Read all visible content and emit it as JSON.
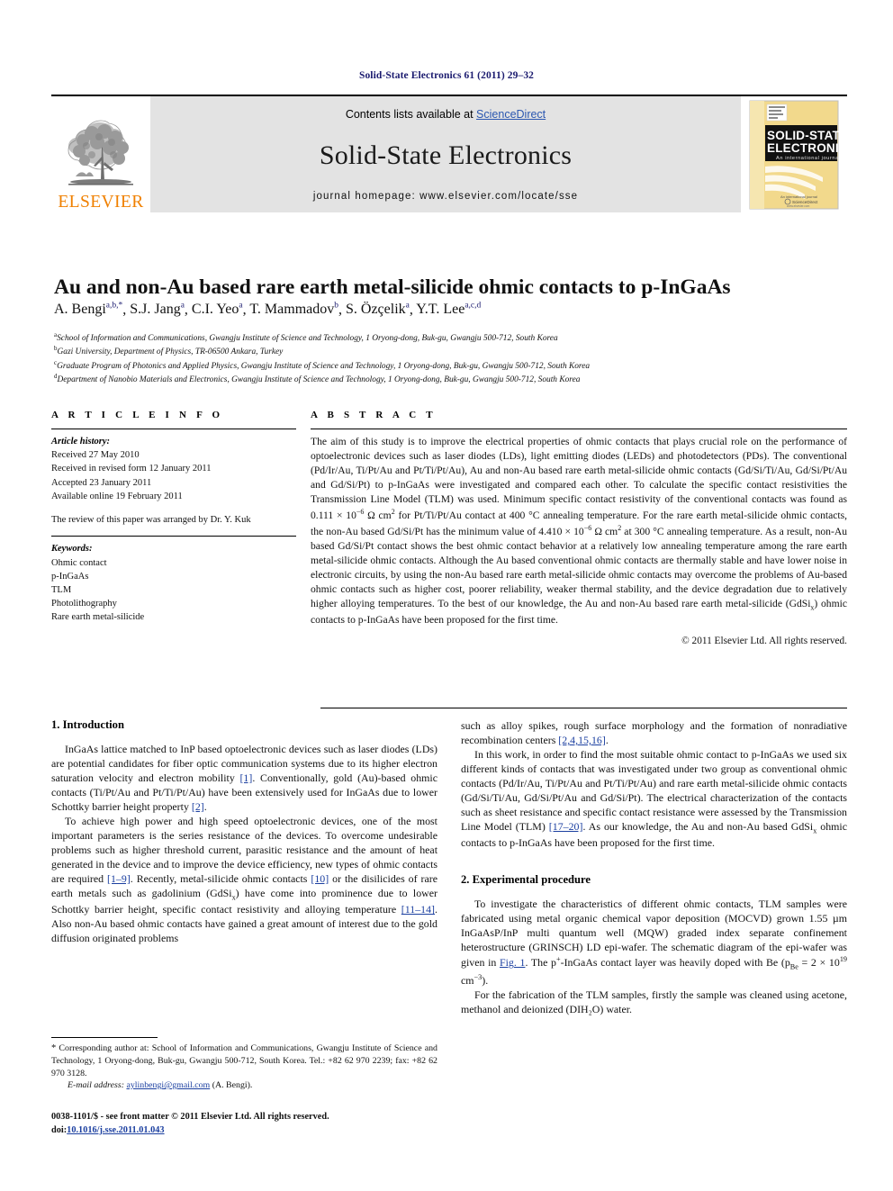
{
  "running_head": "Solid-State Electronics 61 (2011) 29–32",
  "masthead": {
    "publisher_word": "ELSEVIER",
    "publisher_logo_name": "elsevier-tree-logo",
    "contents_prefix": "Contents lists available at ",
    "contents_link": "ScienceDirect",
    "journal_name": "Solid-State Electronics",
    "homepage": "journal homepage: www.elsevier.com/locate/sse",
    "cover": {
      "line1": "SOLID-STATE",
      "line2": "ELECTRONICS",
      "subtitle": "An international journal",
      "footer": "ScienceDirect",
      "footer_sub": "www.elsevier.com"
    }
  },
  "article": {
    "title": "Au and non-Au based rare earth metal-silicide ohmic contacts to p-InGaAs",
    "authors": [
      {
        "name": "A. Bengi",
        "sup": "a,b,*"
      },
      {
        "name": "S.J. Jang",
        "sup": "a"
      },
      {
        "name": "C.I. Yeo",
        "sup": "a"
      },
      {
        "name": "T. Mammadov",
        "sup": "b"
      },
      {
        "name": "S. Özçelik",
        "sup": "a"
      },
      {
        "name": "Y.T. Lee",
        "sup": "a,c,d"
      }
    ],
    "affiliations": [
      {
        "marker": "a",
        "text": "School of Information and Communications, Gwangju Institute of Science and Technology, 1 Oryong-dong, Buk-gu, Gwangju 500-712, South Korea"
      },
      {
        "marker": "b",
        "text": "Gazi University, Department of Physics, TR-06500 Ankara, Turkey"
      },
      {
        "marker": "c",
        "text": "Graduate Program of Photonics and Applied Physics, Gwangju Institute of Science and Technology, 1 Oryong-dong, Buk-gu, Gwangju 500-712, South Korea"
      },
      {
        "marker": "d",
        "text": "Department of Nanobio Materials and Electronics, Gwangju Institute of Science and Technology, 1 Oryong-dong, Buk-gu, Gwangju 500-712, South Korea"
      }
    ]
  },
  "article_info": {
    "heading": "A R T I C L E   I N F O",
    "history_label": "Article history:",
    "history": [
      "Received 27 May 2010",
      "Received in revised form 12 January 2011",
      "Accepted 23 January 2011",
      "Available online 19 February 2011"
    ],
    "editor_note": "The review of this paper was arranged by Dr. Y. Kuk",
    "keywords_label": "Keywords:",
    "keywords": [
      "Ohmic contact",
      "p-InGaAs",
      "TLM",
      "Photolithography",
      "Rare earth metal-silicide"
    ]
  },
  "abstract": {
    "heading": "A B S T R A C T",
    "p1_a": "The aim of this study is to improve the electrical properties of ohmic contacts that plays crucial role on the performance of optoelectronic devices such as laser diodes (LDs), light emitting diodes (LEDs) and photodetectors (PDs). The conventional (Pd/Ir/Au, Ti/Pt/Au and Pt/Ti/Pt/Au), Au and non-Au based rare earth metal-silicide ohmic contacts (Gd/Si/Ti/Au, Gd/Si/Pt/Au and Gd/Si/Pt) to p-InGaAs were investigated and compared each other. To calculate the specific contact resistivities the Transmission Line Model (TLM) was used. Minimum specific contact resistivity of the conventional contacts was found as 0.111 × 10",
    "exp1": "−6",
    "p1_b": " Ω cm",
    "sq1": "2",
    "p1_c": " for Pt/Ti/Pt/Au contact at 400 °C annealing temperature. For the rare earth metal-silicide ohmic contacts, the non-Au based Gd/Si/Pt has the minimum value of 4.410 × 10",
    "exp2": "−6",
    "p1_d": " Ω cm",
    "sq2": "2",
    "p1_e": " at 300 °C annealing temperature. As a result, non-Au based Gd/Si/Pt contact shows the best ohmic contact behavior at a relatively low annealing temperature among the rare earth metal-silicide ohmic contacts. Although the Au based conventional ohmic contacts are thermally stable and have lower noise in electronic circuits, by using the non-Au based rare earth metal-silicide ohmic contacts may overcome the problems of Au-based ohmic contacts such as higher cost, poorer reliability, weaker thermal stability, and the device degradation due to relatively higher alloying temperatures. To the best of our knowledge, the Au and non-Au based rare earth metal-silicide (GdSi",
    "sub1": "x",
    "p1_f": ") ohmic contacts to p-InGaAs have been proposed for the first time.",
    "copyright": "© 2011 Elsevier Ltd. All rights reserved."
  },
  "sections": {
    "intro_heading": "1. Introduction",
    "intro_p1_a": "InGaAs lattice matched to InP based optoelectronic devices such as laser diodes (LDs) are potential candidates for fiber optic communication systems due to its higher electron saturation velocity and electron mobility ",
    "intro_p1_r1": "[1]",
    "intro_p1_b": ". Conventionally, gold (Au)-based ohmic contacts (Ti/Pt/Au and Pt/Ti/Pt/Au) have been extensively used for InGaAs due to lower Schottky barrier height property ",
    "intro_p1_r2": "[2]",
    "intro_p1_c": ".",
    "intro_p2_a": "To achieve high power and high speed optoelectronic devices, one of the most important parameters is the series resistance of the devices. To overcome undesirable problems such as higher threshold current, parasitic resistance and the amount of heat generated in the device and to improve the device efficiency, new types of ohmic contacts are required ",
    "intro_p2_r1": "[1–9]",
    "intro_p2_b": ". Recently, metal-silicide ohmic contacts ",
    "intro_p2_r2": "[10]",
    "intro_p2_c": " or the disilicides of rare earth metals such as gadolinium (GdSi",
    "intro_p2_sub": "x",
    "intro_p2_d": ") have come into prominence due to lower Schottky barrier height, specific contact resistivity and alloying temperature ",
    "intro_p2_r3": "[11–14]",
    "intro_p2_e": ". Also non-Au based ohmic contacts have gained a great amount of interest due to the gold diffusion originated problems",
    "intro_p3_a": "such as alloy spikes, rough surface morphology and the formation of nonradiative recombination centers ",
    "intro_p3_r1": "[2,4,15,16]",
    "intro_p3_b": ".",
    "intro_p4_a": "In this work, in order to find the most suitable ohmic contact to p-InGaAs we used six different kinds of contacts that was investigated under two group as conventional ohmic contacts (Pd/Ir/Au, Ti/Pt/Au and Pt/Ti/Pt/Au) and rare earth metal-silicide ohmic contacts (Gd/Si/Ti/Au, Gd/Si/Pt/Au and Gd/Si/Pt). The electrical characterization of the contacts such as sheet resistance and specific contact resistance were assessed by the Transmission Line Model (TLM) ",
    "intro_p4_r1": "[17–20]",
    "intro_p4_b": ". As our knowledge, the Au and non-Au based GdSi",
    "intro_p4_sub": "x",
    "intro_p4_c": " ohmic contacts to p-InGaAs have been proposed for the first time.",
    "exp_heading": "2. Experimental procedure",
    "exp_p1_a": "To investigate the characteristics of different ohmic contacts, TLM samples were fabricated using metal organic chemical vapor deposition (MOCVD) grown 1.55 µm InGaAsP/InP multi quantum well (MQW) graded index separate confinement heterostructure (GRINSCH) LD epi-wafer. The schematic diagram of the epi-wafer was given in ",
    "exp_p1_fig": "Fig. 1",
    "exp_p1_b": ". The p",
    "exp_p1_sup": "+",
    "exp_p1_c": "-InGaAs contact layer was heavily doped with Be (p",
    "exp_p1_sub1": "Be",
    "exp_p1_d": " = 2 × 10",
    "exp_p1_sup2": "19",
    "exp_p1_e": " cm",
    "exp_p1_sup3": "−3",
    "exp_p1_f": ").",
    "exp_p2": "For the fabrication of the TLM samples, firstly the sample was cleaned using acetone, methanol and deionized (DIH₂O) water."
  },
  "footnote": {
    "star": "*",
    "corr_text": " Corresponding author at: School of Information and Communications, Gwangju Institute of Science and Technology, 1 Oryong-dong, Buk-gu, Gwangju 500-712, South Korea. Tel.: +82 62 970 2239; fax: +82 62 970 3128.",
    "email_label": "E-mail address:",
    "email": "aylinbengi@gmail.com",
    "email_suffix": " (A. Bengi).",
    "issn_line": "0038-1101/$ - see front matter © 2011 Elsevier Ltd. All rights reserved.",
    "doi_prefix": "doi:",
    "doi": "10.1016/j.sse.2011.01.043"
  },
  "colors": {
    "running_head": "#1b1b6f",
    "link": "#1b3fa0",
    "sciencedirect": "#2b57b0",
    "elsevier_orange": "#F08000",
    "banner_bg": "#e3e3e3"
  }
}
